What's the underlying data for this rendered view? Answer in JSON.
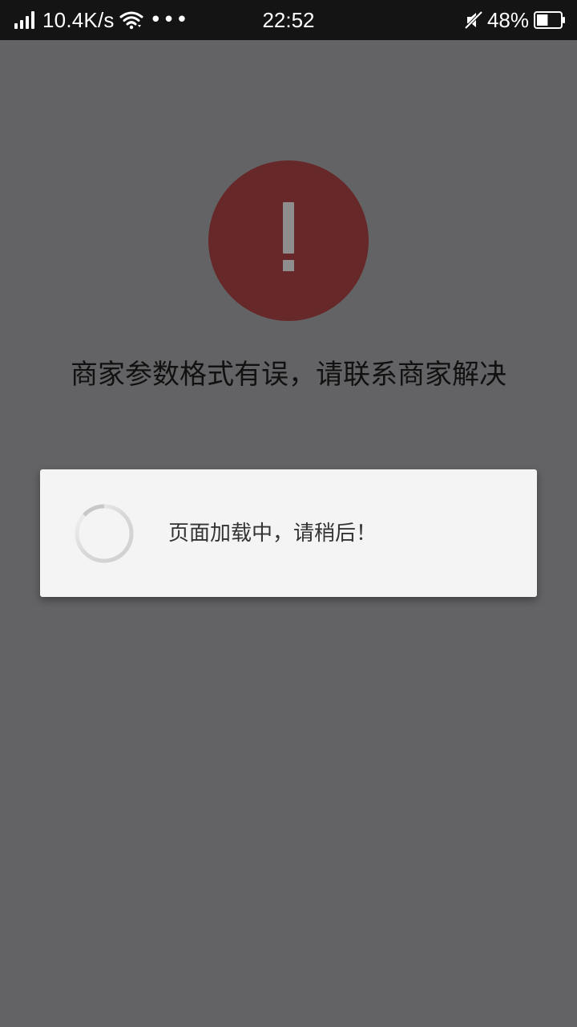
{
  "status_bar": {
    "network_speed": "10.4K/s",
    "more_indicator": "•••",
    "time": "22:52",
    "battery_percent": "48%",
    "icons": [
      "signal-icon",
      "wifi-icon",
      "more-icon",
      "mute-icon",
      "battery-icon"
    ],
    "battery_level": 0.48
  },
  "error": {
    "icon": "error-exclamation-icon",
    "message": "商家参数格式有误，请联系商家解决"
  },
  "loading_dialog": {
    "message": "页面加载中，请稍后！",
    "icon": "loading-spinner-icon"
  },
  "colors": {
    "background": "#636365",
    "status_bar": "#141414",
    "error_circle": "#662829",
    "dialog": "#f4f4f4"
  }
}
